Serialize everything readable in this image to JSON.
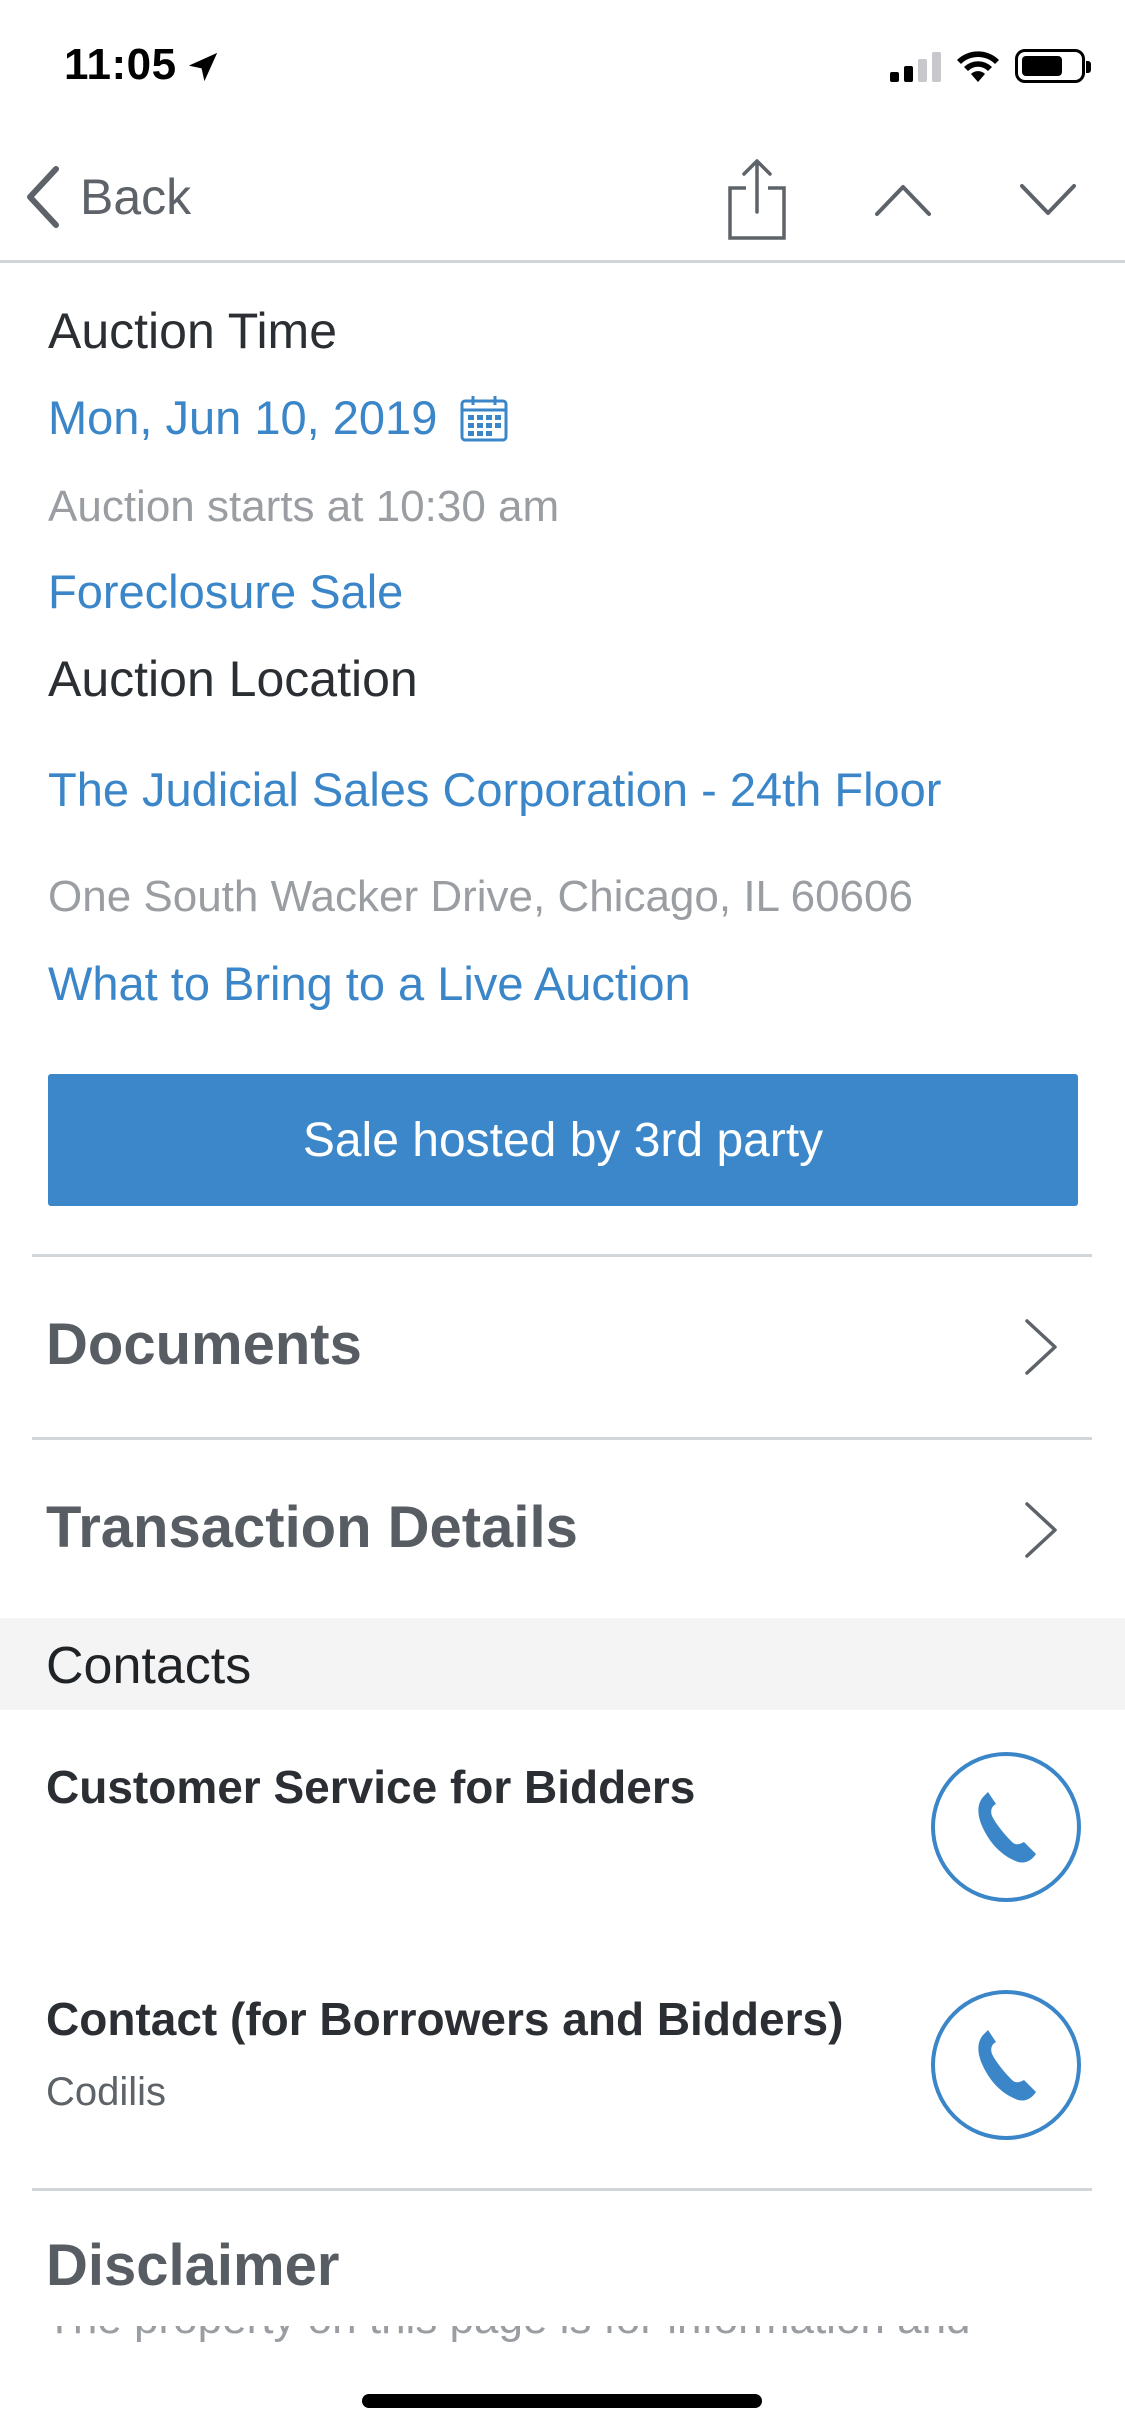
{
  "status_bar": {
    "time": "11:05"
  },
  "nav": {
    "back_label": "Back"
  },
  "auction": {
    "time_heading": "Auction Time",
    "date": "Mon, Jun 10, 2019",
    "start_text": "Auction starts at 10:30 am",
    "sale_type": "Foreclosure Sale",
    "location_heading": "Auction Location",
    "venue": "The Judicial Sales Corporation - 24th Floor",
    "address": "One South Wacker Drive, Chicago, IL 60606",
    "bring_link": "What to Bring to a Live Auction",
    "host_button": "Sale hosted by 3rd party"
  },
  "rows": {
    "documents": "Documents",
    "transaction_details": "Transaction Details"
  },
  "contacts": {
    "section_title": "Contacts",
    "items": [
      {
        "title": "Customer Service for Bidders",
        "subtitle": ""
      },
      {
        "title": "Contact (for Borrowers and Bidders)",
        "subtitle": "Codilis"
      }
    ]
  },
  "disclaimer": {
    "title": "Disclaimer",
    "text": "The property on this page is for information and"
  },
  "colors": {
    "accent": "#3B87C9",
    "divider": "#D3D6D9",
    "band": "#F4F4F5"
  },
  "icons": [
    "location-arrow-icon",
    "signal-icon",
    "wifi-icon",
    "battery-icon",
    "back-chevron-icon",
    "share-icon",
    "chevron-up-icon",
    "chevron-down-icon",
    "calendar-icon",
    "chevron-right-icon",
    "phone-icon"
  ]
}
